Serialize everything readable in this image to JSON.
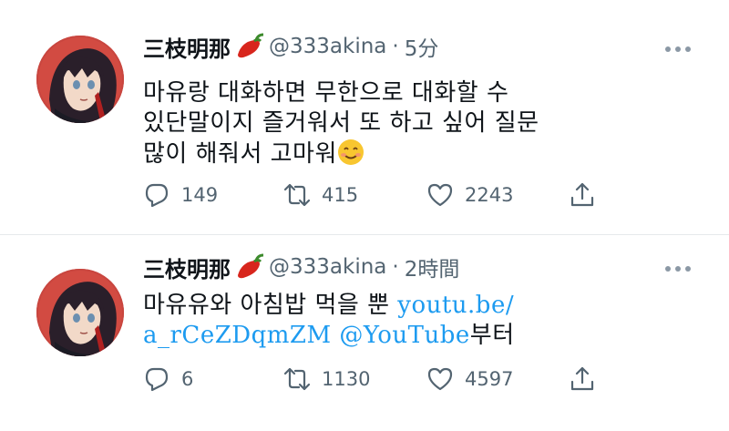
{
  "tweets": [
    {
      "name": "三枝明那",
      "handle": "@333akina",
      "separator": "·",
      "time": "5分",
      "text_lines": [
        "마유랑 대화하면 무한으로 대화할 수",
        "있단말이지 즐거워서 또 하고 싶어 질문",
        "많이 해줘서 고마워"
      ],
      "replies": "149",
      "retweets": "415",
      "likes": "2243"
    },
    {
      "name": "三枝明那",
      "handle": "@333akina",
      "separator": "·",
      "time": "2時間",
      "text_start": "마유유와 아침밥 먹을 뿐 ",
      "link1_part1": "youtu.be/",
      "link1_part2": "a_rCeZDqmZM",
      "link2": "@YouTube",
      "text_end": "부터",
      "replies": "6",
      "retweets": "1130",
      "likes": "4597"
    }
  ],
  "icons": [
    "reply-icon",
    "retweet-icon",
    "like-icon",
    "share-icon",
    "more-icon",
    "chili-emoji",
    "smile-emoji"
  ],
  "colors": {
    "text": "#0f1419",
    "secondary": "#536471",
    "link": "#1d9bf0",
    "divider": "#e6e9ec"
  }
}
